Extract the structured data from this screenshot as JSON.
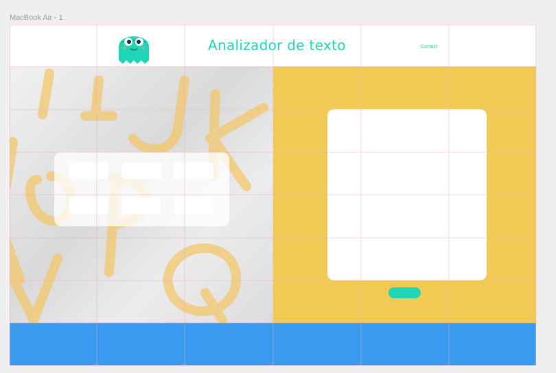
{
  "canvas": {
    "frame_label": "MacBook Air - 1"
  },
  "header": {
    "logo_icon": "ghost-mascot-icon",
    "title": "Analizador de texto",
    "contact_label": "Contact"
  },
  "left_panel": {
    "background_letters": [
      "I",
      "J",
      "K",
      "O",
      "P",
      "V",
      "Q"
    ],
    "letter_color": "#f2c76a",
    "input_slots": 6
  },
  "right_panel": {
    "background_color": "#f1c955"
  },
  "analyze_button": {
    "color": "#1fd6b4"
  },
  "footer": {
    "background_color": "#3a9af0"
  },
  "colors": {
    "accent": "#1fd6b4",
    "yellow": "#f1c955",
    "blue": "#3a9af0",
    "grid": "#f4a6b8"
  }
}
